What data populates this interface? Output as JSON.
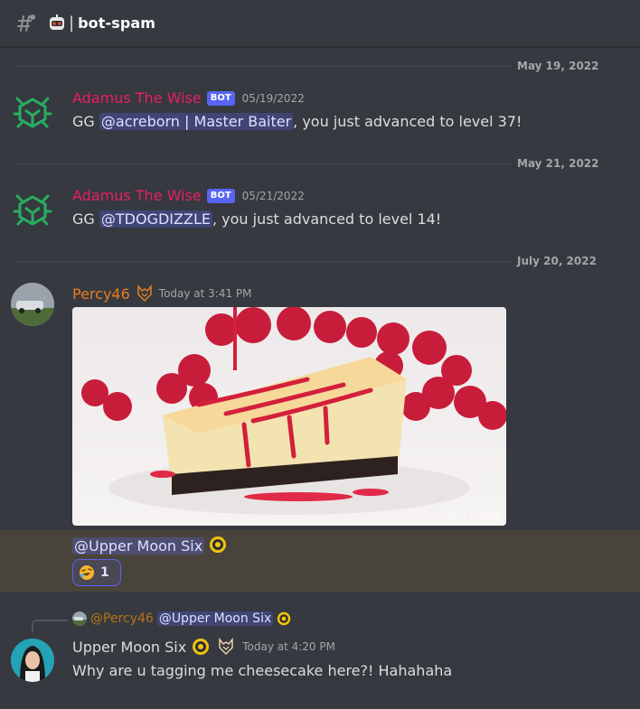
{
  "channel": {
    "name": "bot-spam",
    "icon": "hash-threads-icon",
    "emoji": "robot-face-icon"
  },
  "dividers": [
    "May 19, 2022",
    "May 21, 2022",
    "July 20, 2022"
  ],
  "messages": [
    {
      "username": "Adamus The Wise",
      "bot_tag": "BOT",
      "timestamp": "05/19/2022",
      "prefix": "GG ",
      "mention": "@acreborn | Master Baiter",
      "suffix": ", you just advanced to level 37!",
      "avatar": "bot-logo-icon",
      "username_color": "#e91e63"
    },
    {
      "username": "Adamus The Wise",
      "bot_tag": "BOT",
      "timestamp": "05/21/2022",
      "prefix": "GG ",
      "mention": "@TDOGDIZZLE",
      "suffix": ", you just advanced to level 14!",
      "avatar": "bot-logo-icon",
      "username_color": "#e91e63"
    },
    {
      "username": "Percy46",
      "timestamp": "Today at 3:41 PM",
      "image_watermark": "FATTY FOOD",
      "mention": "@Upper Moon Six",
      "reaction": {
        "emoji": "rolling-on-floor-laughing-icon",
        "count": "1"
      },
      "username_color": "#e67e22"
    },
    {
      "reply_to_user": "@Percy46",
      "reply_mention": "@Upper Moon Six",
      "username": "Upper Moon Six",
      "timestamp": "Today at 4:20 PM",
      "text": "Why are u tagging me cheesecake here?! Hahahaha",
      "username_color": "#dcddde"
    }
  ],
  "colors": {
    "background": "#36393f",
    "mention_bg": "#4a4f8a",
    "highlight": "#443f35",
    "blurple": "#5865f2"
  }
}
